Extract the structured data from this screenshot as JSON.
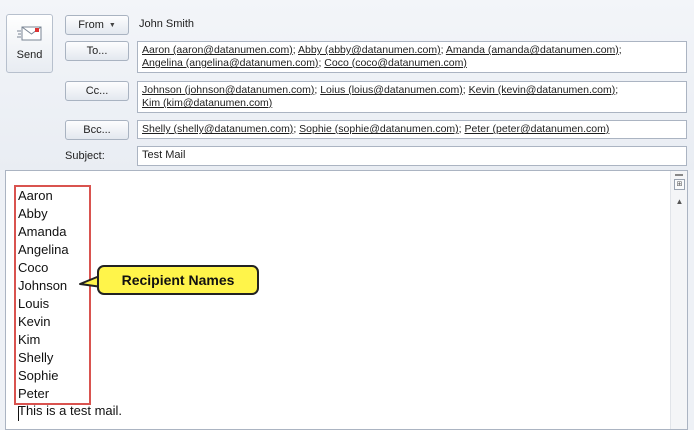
{
  "send_button": {
    "label": "Send",
    "icon": "send-mail-icon"
  },
  "from": {
    "button_label": "From",
    "value": "John Smith"
  },
  "to": {
    "button_label": "To...",
    "recipients": [
      "Aaron (aaron@datanumen.com)",
      "Abby (abby@datanumen.com)",
      "Amanda (amanda@datanumen.com)",
      "Angelina (angelina@datanumen.com)",
      "Coco (coco@datanumen.com)"
    ]
  },
  "cc": {
    "button_label": "Cc...",
    "recipients": [
      "Johnson (johnson@datanumen.com)",
      "Loius (loius@datanumen.com)",
      "Kevin (kevin@datanumen.com)",
      "Kim (kim@datanumen.com)"
    ]
  },
  "bcc": {
    "button_label": "Bcc...",
    "recipients": [
      "Shelly (shelly@datanumen.com)",
      "Sophie (sophie@datanumen.com)",
      "Peter (peter@datanumen.com)"
    ]
  },
  "subject": {
    "label": "Subject:",
    "value": "Test Mail"
  },
  "body": {
    "names": [
      "Aaron",
      "Abby",
      "Amanda",
      "Angelina",
      "Coco",
      "Johnson",
      "Louis",
      "Kevin",
      "Kim",
      "Shelly",
      "Sophie",
      "Peter"
    ],
    "text": "This is a test mail."
  },
  "callout": {
    "text": "Recipient Names"
  },
  "colors": {
    "highlight_box": "#d9534f",
    "callout_fill": "#fff44a"
  }
}
